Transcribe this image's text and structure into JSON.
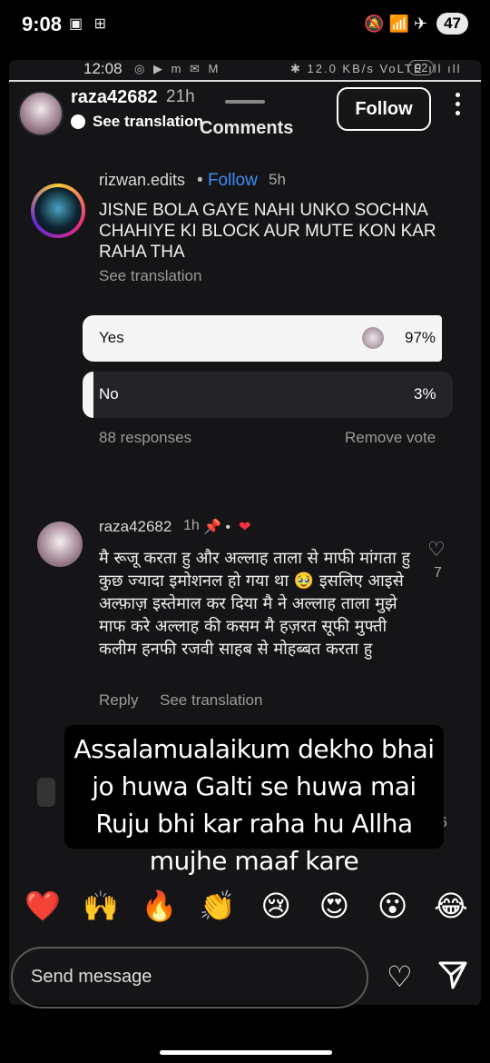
{
  "status_bar": {
    "time": "9:08",
    "left_icons": "▣ ⊞",
    "right_icons": "🔕 📶 ✈",
    "battery": "47"
  },
  "story": {
    "inner_status": {
      "time": "12:08",
      "icons": "◎ ▶ m ✉ M",
      "right": "✱ 12.0 KB/s VoLTE ıll ıll",
      "battery": "92"
    },
    "owner": {
      "username": "raza42682",
      "time": "21h",
      "see_translation": "See translation"
    },
    "comments_title": "Comments",
    "follow_button": "Follow",
    "comment1": {
      "username": "rizwan.edits",
      "separator": "•",
      "follow": "Follow",
      "time": "5h",
      "text": "JISNE BOLA GAYE NAHI UNKO SOCHNA CHAHIYE KI BLOCK AUR MUTE KON KAR RAHA THA",
      "see_translation": "See translation"
    },
    "poll": {
      "options": [
        {
          "label": "Yes",
          "percent_label": "97%",
          "share": 0.97
        },
        {
          "label": "No",
          "percent_label": "3%",
          "share": 0.03
        }
      ],
      "responses": "88 responses",
      "remove_vote": "Remove vote"
    },
    "comment2": {
      "username": "raza42682",
      "time": "1h",
      "pin": "📌 •",
      "heart": "❤",
      "text": "मै रूजू करता हु और अल्लाह ताला से माफी मांगता हु  कुछ ज्यादा इमोशनल हो गया था 🥹 इसलिए आइसे अल्फ़ाज़ इस्तेमाल कर दिया मै ने अल्लाह ताला मुझे माफ करे अल्लाह की कसम मै हज़रत सूफी मुफ्ती कलीम हनफी  रजवी साहब से मोहब्बत करता हु",
      "reply": "Reply",
      "see_translation": "See translation",
      "likes": "7"
    },
    "comment3": {
      "likes": "16"
    },
    "overlay_text": "Assalamualaikum dekho bhai jo huwa Galti se huwa mai Ruju bhi kar raha hu Allha mujhe maaf kare",
    "emojis": [
      "❤️",
      "🙌",
      "🔥",
      "👏",
      "😢",
      "😍",
      "😮",
      "😂"
    ]
  },
  "send_message_placeholder": "Send message",
  "colors": {
    "follow_blue": "#3b8ff5",
    "heart_red": "#ff3040",
    "background": "#000000"
  }
}
